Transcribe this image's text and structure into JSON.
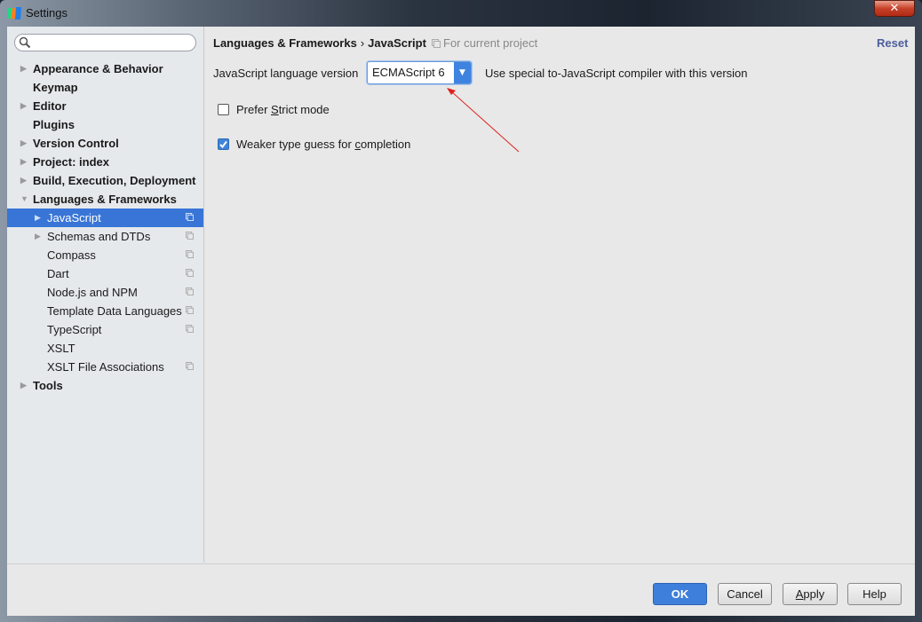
{
  "window": {
    "title": "Settings",
    "close_label": "✕"
  },
  "sidebar": {
    "search": {
      "placeholder": "",
      "value": ""
    },
    "items": [
      {
        "label": "Appearance & Behavior",
        "level": 0,
        "expandable": true,
        "expanded": false,
        "project_scope": false
      },
      {
        "label": "Keymap",
        "level": 0,
        "expandable": false,
        "project_scope": false
      },
      {
        "label": "Editor",
        "level": 0,
        "expandable": true,
        "expanded": false,
        "project_scope": false
      },
      {
        "label": "Plugins",
        "level": 0,
        "expandable": false,
        "project_scope": false
      },
      {
        "label": "Version Control",
        "level": 0,
        "expandable": true,
        "expanded": false,
        "project_scope": false
      },
      {
        "label": "Project: index",
        "level": 0,
        "expandable": true,
        "expanded": false,
        "project_scope": false
      },
      {
        "label": "Build, Execution, Deployment",
        "level": 0,
        "expandable": true,
        "expanded": false,
        "project_scope": false
      },
      {
        "label": "Languages & Frameworks",
        "level": 0,
        "expandable": true,
        "expanded": true,
        "project_scope": false
      },
      {
        "label": "JavaScript",
        "level": 1,
        "expandable": true,
        "expanded": false,
        "selected": true,
        "project_scope": true
      },
      {
        "label": "Schemas and DTDs",
        "level": 1,
        "expandable": true,
        "expanded": false,
        "project_scope": true
      },
      {
        "label": "Compass",
        "level": 1,
        "expandable": false,
        "project_scope": true
      },
      {
        "label": "Dart",
        "level": 1,
        "expandable": false,
        "project_scope": true
      },
      {
        "label": "Node.js and NPM",
        "level": 1,
        "expandable": false,
        "project_scope": true
      },
      {
        "label": "Template Data Languages",
        "level": 1,
        "expandable": false,
        "project_scope": true
      },
      {
        "label": "TypeScript",
        "level": 1,
        "expandable": false,
        "project_scope": true
      },
      {
        "label": "XSLT",
        "level": 1,
        "expandable": false,
        "project_scope": false
      },
      {
        "label": "XSLT File Associations",
        "level": 1,
        "expandable": false,
        "project_scope": true
      },
      {
        "label": "Tools",
        "level": 0,
        "expandable": true,
        "expanded": false,
        "project_scope": false
      }
    ]
  },
  "main": {
    "breadcrumb": {
      "parent": "Languages & Frameworks",
      "separator": "›",
      "current": "JavaScript"
    },
    "scope_note": "For current project",
    "reset_label": "Reset",
    "language_version": {
      "label": "JavaScript language version",
      "selected": "ECMAScript 6",
      "hint": "Use special to-JavaScript compiler with this version"
    },
    "options": [
      {
        "pre": "Prefer ",
        "mnemonic": "S",
        "post": "trict mode",
        "checked": false
      },
      {
        "pre": "Weaker type guess for ",
        "mnemonic": "c",
        "post": "ompletion",
        "checked": true
      }
    ]
  },
  "footer": {
    "ok_label": "OK",
    "cancel_label": "Cancel",
    "apply": {
      "mnemonic": "A",
      "rest": "pply"
    },
    "help_label": "Help"
  },
  "colors": {
    "selection": "#3875d7",
    "accent": "#3e7fdb",
    "annotation_arrow": "#e02020",
    "reset_link": "#4d5e9c"
  }
}
